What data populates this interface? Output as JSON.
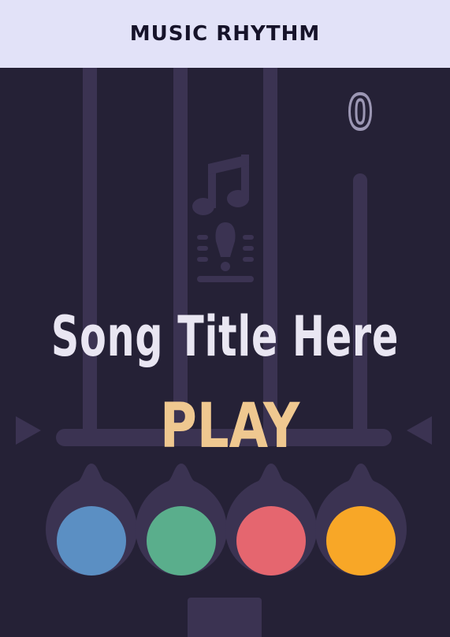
{
  "header": {
    "title": "MUSIC RHYTHM"
  },
  "game": {
    "score": "0",
    "song_title": "Song Title Here",
    "play_label": "PLAY"
  },
  "pads": [
    {
      "name": "blue",
      "color": "#5b8fc3"
    },
    {
      "name": "green",
      "color": "#5aae8c"
    },
    {
      "name": "red",
      "color": "#e5666f"
    },
    {
      "name": "orange",
      "color": "#f8a727"
    }
  ],
  "colors": {
    "background": "#252136",
    "lane": "#3b3352",
    "header_bg": "#e2e2f8",
    "play": "#efc890"
  }
}
